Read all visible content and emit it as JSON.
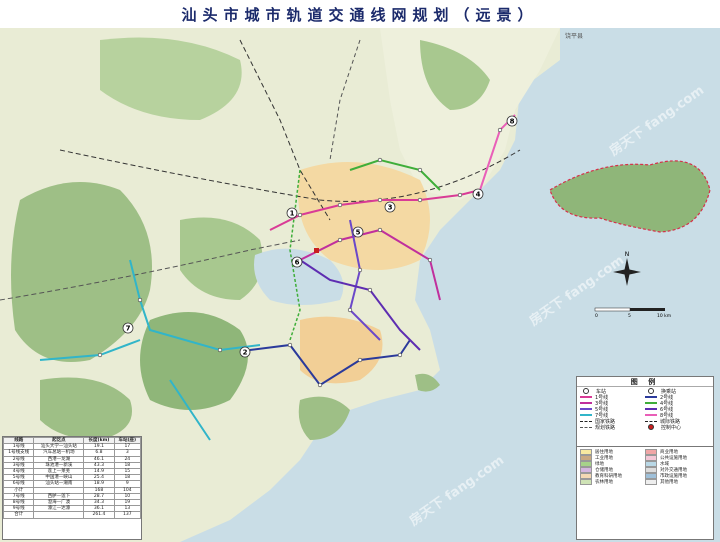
{
  "title": "汕头市城市轨道交通线网规划（远景）",
  "map_labels": {
    "north_arrow": "N",
    "scale_km": [
      "0",
      "5",
      "10 km"
    ],
    "rao_ping": "饶平县",
    "watermark": "房天下 fang.com"
  },
  "line_markers": [
    "1",
    "2",
    "3",
    "4",
    "5",
    "6",
    "7",
    "8"
  ],
  "legend": {
    "title": "图 例",
    "items": [
      {
        "label": "车站",
        "kind": "dot",
        "color": "#ffffff"
      },
      {
        "label": "换乘站",
        "kind": "dot",
        "color": "#ffffff"
      },
      {
        "label": "1号线",
        "kind": "line",
        "color": "#d93b96"
      },
      {
        "label": "2号线",
        "kind": "line",
        "color": "#2b3a9b"
      },
      {
        "label": "3号线",
        "kind": "line",
        "color": "#c02f9d"
      },
      {
        "label": "4号线",
        "kind": "line",
        "color": "#3fae3a"
      },
      {
        "label": "5号线",
        "kind": "line",
        "color": "#6b48c9"
      },
      {
        "label": "6号线",
        "kind": "line",
        "color": "#5e2db1"
      },
      {
        "label": "7号线",
        "kind": "line",
        "color": "#31b5c9"
      },
      {
        "label": "8号线",
        "kind": "line",
        "color": "#e95fb8"
      },
      {
        "label": "国家铁路",
        "kind": "dash",
        "color": "#222222"
      },
      {
        "label": "城际铁路",
        "kind": "dash",
        "color": "#222222"
      },
      {
        "label": "规划铁路",
        "kind": "dash",
        "color": "#555555"
      },
      {
        "label": "控制中心",
        "kind": "dot",
        "color": "#c81e1e"
      }
    ]
  },
  "landuse": {
    "items": [
      {
        "label": "居住用地",
        "color": "#f7e9a0"
      },
      {
        "label": "商业用地",
        "color": "#f0a6a6"
      },
      {
        "label": "工业用地",
        "color": "#c8a882"
      },
      {
        "label": "公共设施用地",
        "color": "#f4c7d6"
      },
      {
        "label": "绿地",
        "color": "#a6d28a"
      },
      {
        "label": "水域",
        "color": "#b9d8e6"
      },
      {
        "label": "仓储用地",
        "color": "#d3b5e0"
      },
      {
        "label": "对外交通用地",
        "color": "#dddddd"
      },
      {
        "label": "教育科研用地",
        "color": "#f3d8b4"
      },
      {
        "label": "市政设施用地",
        "color": "#9fc0d9"
      },
      {
        "label": "农林用地",
        "color": "#cfe3b6"
      },
      {
        "label": "其他用地",
        "color": "#eeeeee"
      }
    ]
  },
  "table": {
    "headers": [
      "线路",
      "起讫点",
      "长度(km)",
      "车站(座)"
    ],
    "rows": [
      [
        "1号线",
        "汕头大学—汕头站",
        "19.1",
        "17"
      ],
      [
        "1号线支线",
        "汽车总站—机场",
        "6.8",
        "3"
      ],
      [
        "2号线",
        "西港—龙湖",
        "46.1",
        "24"
      ],
      [
        "3号线",
        "珠池港—新溪",
        "43.3",
        "18"
      ],
      [
        "4号线",
        "莲上—莱芜",
        "14.9",
        "15"
      ],
      [
        "5号线",
        "中国港—峡山",
        "25.4",
        "18"
      ],
      [
        "6号线",
        "汕头站—潮南",
        "18.9",
        "9"
      ],
      [
        "小计",
        "",
        "168",
        "104"
      ],
      [
        "7号线",
        "西胪—莲下",
        "28.7",
        "10"
      ],
      [
        "8号线",
        "澄海—广澳",
        "34.3",
        "19"
      ],
      [
        "9号线",
        "濠江—达濠",
        "36.1",
        "13"
      ],
      [
        "合计",
        "",
        "261.4",
        "137"
      ]
    ]
  }
}
